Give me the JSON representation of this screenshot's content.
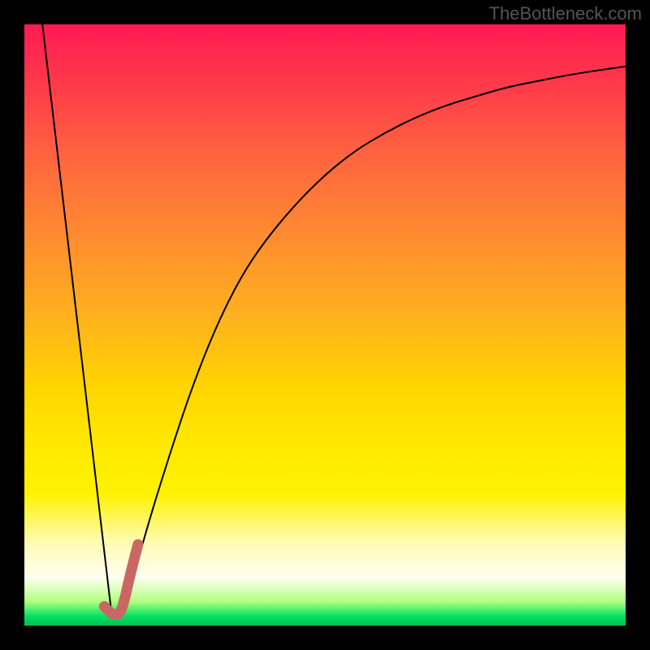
{
  "watermark": "TheBottleneck.com",
  "chart_data": {
    "type": "line",
    "title": "",
    "xlabel": "",
    "ylabel": "",
    "xlim": [
      0,
      100
    ],
    "ylim": [
      0,
      100
    ],
    "grid": false,
    "legend": false,
    "series": [
      {
        "name": "left-limb",
        "stroke": "#000000",
        "strokeWidth": 2,
        "x": [
          3,
          14.5
        ],
        "y": [
          100,
          2
        ]
      },
      {
        "name": "right-limb",
        "stroke": "#000000",
        "strokeWidth": 2,
        "x": [
          17,
          20,
          24,
          28,
          32,
          36,
          40,
          45,
          50,
          55,
          60,
          65,
          70,
          75,
          80,
          85,
          90,
          95,
          100
        ],
        "y": [
          4,
          15,
          28,
          40,
          50,
          58,
          64,
          70,
          75,
          79,
          82,
          84.5,
          86.5,
          88,
          89.5,
          90.5,
          91.5,
          92.3,
          93
        ]
      },
      {
        "name": "hook-overlay",
        "stroke": "#c96764",
        "strokeWidth": 13,
        "linecap": "round",
        "x": [
          13.3,
          14.5,
          15.8,
          16.6,
          17.6,
          18.9
        ],
        "y": [
          3.2,
          1.8,
          1.8,
          4.0,
          8.5,
          13.5
        ]
      }
    ],
    "background_gradient_stops": [
      {
        "pos": 0,
        "color": "#ff1a53"
      },
      {
        "pos": 10,
        "color": "#ff3a4a"
      },
      {
        "pos": 22,
        "color": "#ff643f"
      },
      {
        "pos": 35,
        "color": "#ff8b30"
      },
      {
        "pos": 48,
        "color": "#ffaf1f"
      },
      {
        "pos": 60,
        "color": "#ffd400"
      },
      {
        "pos": 70,
        "color": "#ffe900"
      },
      {
        "pos": 78,
        "color": "#fff200"
      },
      {
        "pos": 86,
        "color": "#fffbb0"
      },
      {
        "pos": 92,
        "color": "#fffff0"
      },
      {
        "pos": 96,
        "color": "#b0ff80"
      },
      {
        "pos": 98.5,
        "color": "#00e060"
      },
      {
        "pos": 100,
        "color": "#00c050"
      }
    ]
  }
}
